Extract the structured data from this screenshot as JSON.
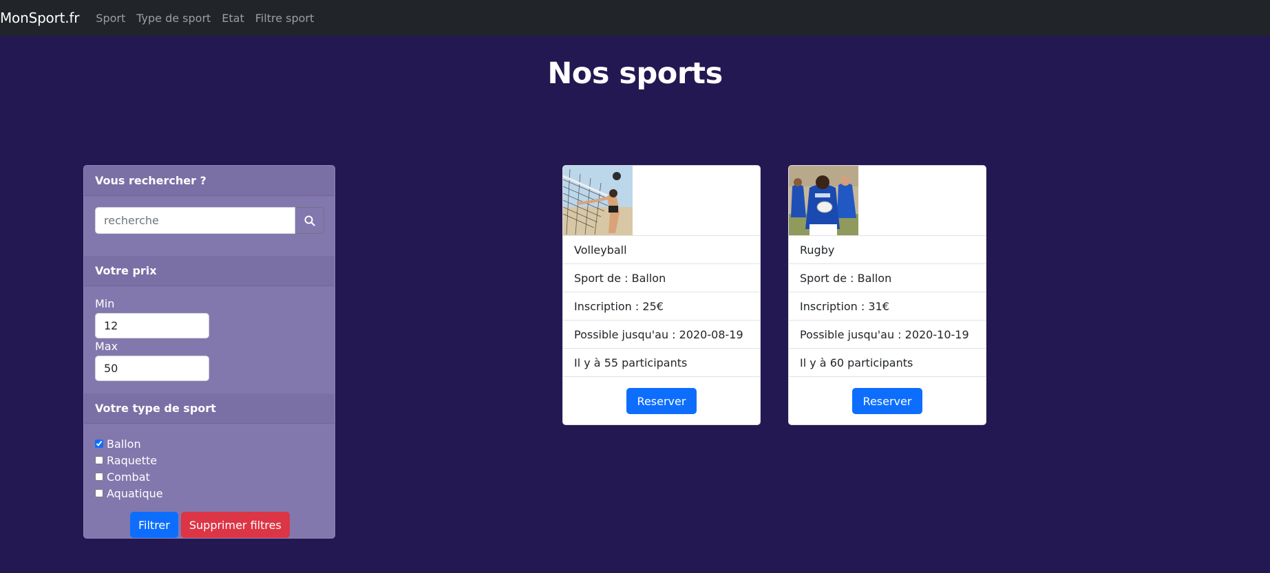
{
  "navbar": {
    "brand": "MonSport.fr",
    "links": [
      "Sport",
      "Type de sport",
      "Etat",
      "Filtre sport"
    ]
  },
  "page": {
    "title": "Nos sports"
  },
  "filters": {
    "search_header": "Vous rechercher ?",
    "search_placeholder": "recherche",
    "search_value": "",
    "price_header": "Votre prix",
    "min_label": "Min",
    "min_value": "12",
    "max_label": "Max",
    "max_value": "50",
    "type_header": "Votre type de sport",
    "types": [
      {
        "label": "Ballon",
        "checked": true
      },
      {
        "label": "Raquette",
        "checked": false
      },
      {
        "label": "Combat",
        "checked": false
      },
      {
        "label": "Aquatique",
        "checked": false
      }
    ],
    "filter_button": "Filtrer",
    "clear_button": "Supprimer filtres"
  },
  "cards": [
    {
      "name": "Volleyball",
      "type": "Sport de : Ballon",
      "price": "Inscription : 25€",
      "until": "Possible jusqu'au : 2020-08-19",
      "participants": "Il y à 55 participants",
      "button": "Reserver"
    },
    {
      "name": "Rugby",
      "type": "Sport de : Ballon",
      "price": "Inscription : 31€",
      "until": "Possible jusqu'au : 2020-10-19",
      "participants": "Il y à 60 participants",
      "button": "Reserver"
    }
  ],
  "colors": {
    "background": "#241852",
    "navbar": "#212529",
    "panel": "#8278ad",
    "primary": "#0d6efd",
    "danger": "#dc3545"
  }
}
